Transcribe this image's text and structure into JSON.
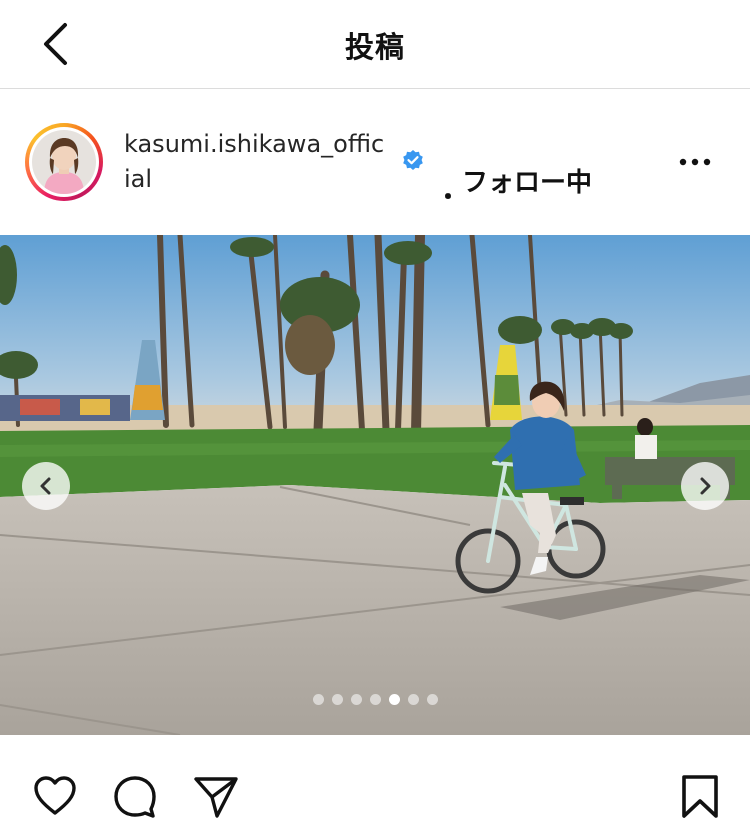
{
  "header": {
    "title": "投稿",
    "back_icon": "chevron-left-icon"
  },
  "post": {
    "username": "kasumi.ishikawa_official",
    "verified": true,
    "follow_separator": "・",
    "follow_status": "フォロー中",
    "more_icon": "more-horizontal-icon"
  },
  "carousel": {
    "slide_count": 7,
    "active_index": 4,
    "prev_icon": "chevron-left-icon",
    "next_icon": "chevron-right-icon"
  },
  "actions": {
    "icons": [
      "heart-icon",
      "comment-icon",
      "share-icon",
      "bookmark-icon"
    ]
  },
  "colors": {
    "verified_badge": "#3897f0",
    "story_ring": [
      "#f9a825",
      "#d81b60"
    ],
    "sky": "#7fb0d8",
    "grass": "#4c8a35",
    "pavement": "#b9b3ab"
  }
}
